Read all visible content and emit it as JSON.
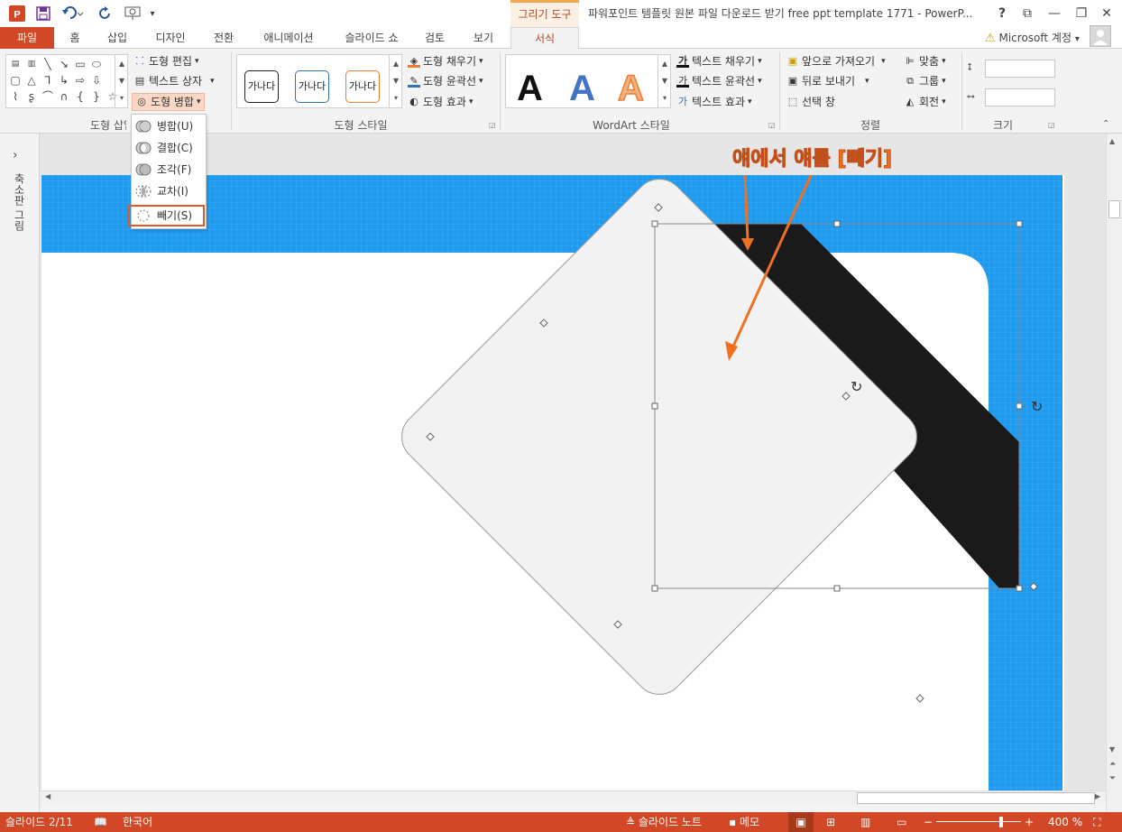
{
  "qat": {
    "app_icon": "powerpoint-icon",
    "save_icon": "save-icon",
    "undo_icon": "undo-icon",
    "redo_icon": "redo-icon",
    "start_icon": "presentation-start-icon",
    "customize_icon": "chevron-down-icon"
  },
  "context_group": "그리기 도구",
  "window_title": "파워포인트 템플릿 원본 파일 다운로드 받기 free ppt template 1771 - PowerP...",
  "window_buttons": {
    "help": "?",
    "ribbon_options": "⧉",
    "minimize": "—",
    "restore": "❐",
    "close": "✕"
  },
  "tabs": [
    "파일",
    "홈",
    "삽입",
    "디자인",
    "전환",
    "애니메이션",
    "슬라이드 쇼",
    "검토",
    "보기",
    "서식"
  ],
  "account": {
    "warning_icon": "warning-icon",
    "label": "Microsoft 계정",
    "dropdown": "▾"
  },
  "ribbon": {
    "insert_shapes": {
      "label": "도형 삽입",
      "edit_shape": "도형 편집",
      "text_box": "텍스트 상자",
      "merge_shapes": "도형 병합"
    },
    "shape_styles": {
      "label": "도형 스타일",
      "samples": [
        "가나다",
        "가나다",
        "가나다"
      ],
      "fill": "도형 채우기",
      "outline": "도형 윤곽선",
      "effects": "도형 효과"
    },
    "wordart": {
      "label": "WordArt 스타일",
      "samples": [
        "A",
        "A",
        "A"
      ],
      "text_fill": "텍스트 채우기",
      "text_outline": "텍스트 윤곽선",
      "text_effects": "텍스트 효과"
    },
    "arrange": {
      "label": "정렬",
      "bring_forward": "앞으로 가져오기",
      "send_backward": "뒤로 보내기",
      "selection_pane": "선택 창",
      "align": "맞춤",
      "group": "그룹",
      "rotate": "회전"
    },
    "size": {
      "label": "크기",
      "height": "",
      "width": ""
    }
  },
  "merge_menu": [
    {
      "label": "병합(U)"
    },
    {
      "label": "결합(C)"
    },
    {
      "label": "조각(F)"
    },
    {
      "label": "교차(I)"
    },
    {
      "label": "빼기(S)"
    }
  ],
  "left_panel": {
    "label": "축소판 그림",
    "expand": "›"
  },
  "annotation": "얘에서 얘를 [빼기]",
  "colors": {
    "accent": "#d24726",
    "slide_blue": "#1e9bf0",
    "annotation": "#f07022",
    "menu_highlight": "#e05a2a",
    "dark_shape": "#1a1a1a",
    "light_shape": "#f2f2f2"
  },
  "status": {
    "slide": "슬라이드 2/11",
    "language": "한국어",
    "notes": "슬라이드 노트",
    "comments": "메모",
    "zoom": "400 %"
  }
}
